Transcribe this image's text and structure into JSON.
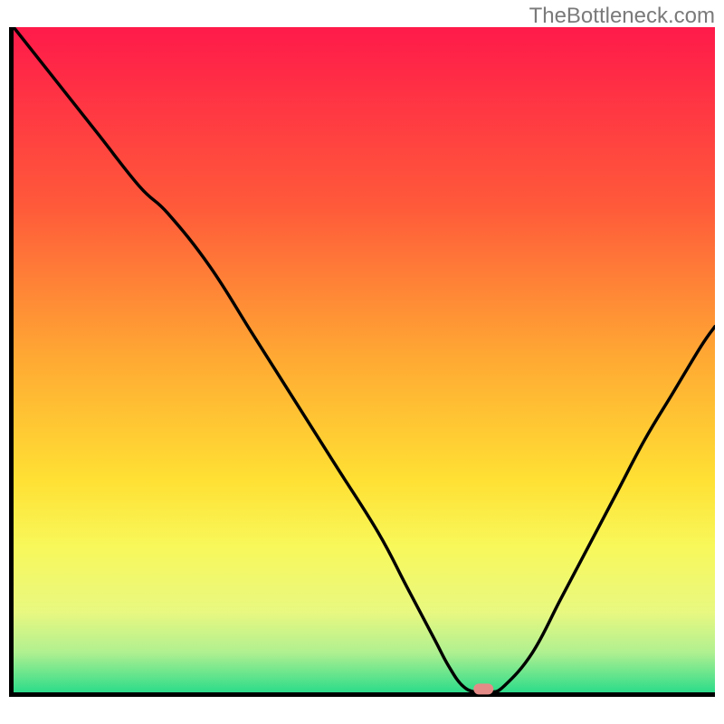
{
  "watermark": "TheBottleneck.com",
  "chart_data": {
    "type": "line",
    "title": "",
    "xlabel": "",
    "ylabel": "",
    "xlim": [
      0,
      100
    ],
    "ylim": [
      0,
      100
    ],
    "grid": false,
    "background": {
      "gradient_stops": [
        {
          "offset": 0,
          "color": "#ff1a4a"
        },
        {
          "offset": 27,
          "color": "#ff5a3a"
        },
        {
          "offset": 50,
          "color": "#ffaa33"
        },
        {
          "offset": 68,
          "color": "#ffe033"
        },
        {
          "offset": 78,
          "color": "#f8f85a"
        },
        {
          "offset": 88,
          "color": "#e8f880"
        },
        {
          "offset": 94,
          "color": "#b0f090"
        },
        {
          "offset": 100,
          "color": "#2cdc8a"
        }
      ]
    },
    "series": [
      {
        "name": "bottleneck-curve",
        "color": "#000000",
        "x": [
          0,
          6,
          12,
          18,
          22,
          28,
          34,
          40,
          46,
          52,
          56,
          60,
          62,
          64,
          66,
          68,
          70,
          74,
          78,
          82,
          86,
          90,
          94,
          98,
          100
        ],
        "y": [
          100,
          92,
          84,
          76,
          72,
          64,
          54,
          44,
          34,
          24,
          16,
          8,
          4,
          1,
          0,
          0,
          1,
          6,
          14,
          22,
          30,
          38,
          45,
          52,
          55
        ]
      }
    ],
    "marker": {
      "name": "optimal-point",
      "x": 67,
      "y": 0.5,
      "color": "#e58b87",
      "shape": "rounded-rect"
    },
    "axes": {
      "left": true,
      "bottom": true,
      "color": "#000000",
      "width": 5
    }
  }
}
